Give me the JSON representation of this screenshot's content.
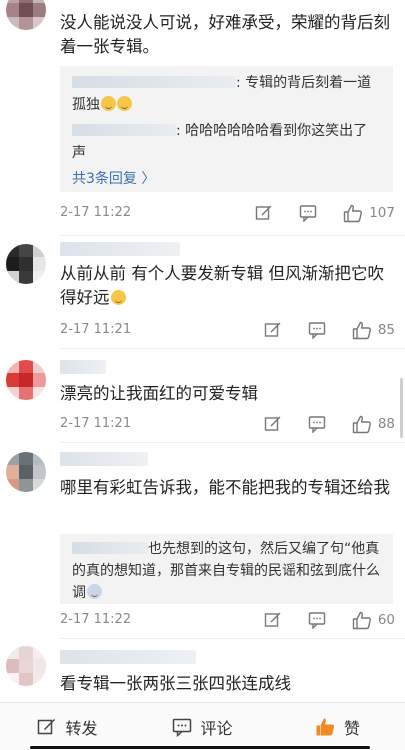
{
  "comments": [
    {
      "text": "没人能说没人可说，好难承受，荣耀的背后刻着一张专辑。",
      "replies": [
        {
          "text": ": 专辑的背后刻着一道孤独"
        },
        {
          "text": ": 哈哈哈哈哈哈看到你这笑出了声"
        }
      ],
      "more": "共3条回复 〉",
      "time": "2-17 11:22",
      "likes": "107"
    },
    {
      "text": "从前从前 有个人要发新专辑 但风渐渐把它吹得好远",
      "time": "2-17 11:21",
      "likes": "85"
    },
    {
      "text": "漂亮的让我面红的可爱专辑",
      "time": "2-17 11:21",
      "likes": "88"
    },
    {
      "text": "哪里有彩虹告诉我，能不能把我的专辑还给我",
      "replies": [
        {
          "text": "也先想到的这句，然后又编了句“他真的真的想知道，那首来自专辑的民谣和弦到底什么调"
        }
      ],
      "time": "2-17 11:22",
      "likes": "60"
    },
    {
      "text": "看专辑一张两张三张四张连成线"
    }
  ],
  "bottom_bar": {
    "repost": "转发",
    "comment": "评论",
    "like": "赞"
  },
  "colors": {
    "link": "#3b6fb3",
    "like_active": "#f08a24"
  },
  "icons": [
    "edit-icon",
    "comment-icon",
    "thumbs-up-icon",
    "emoji-icon"
  ]
}
